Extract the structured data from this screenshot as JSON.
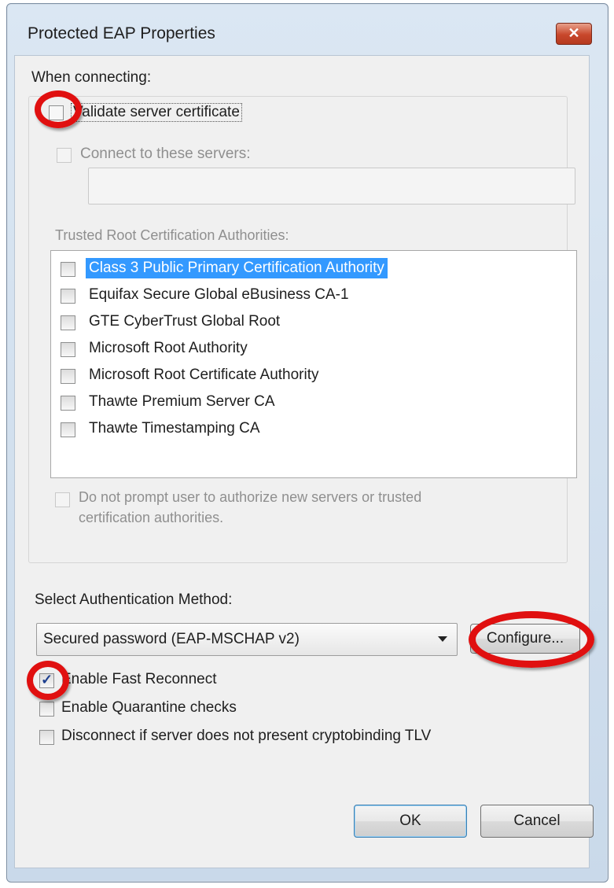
{
  "window": {
    "title": "Protected EAP Properties",
    "close_symbol": "✕"
  },
  "connecting": {
    "heading": "When connecting:",
    "validate_label": "Validate server certificate",
    "validate_checked": false,
    "connect_label": "Connect to these servers:",
    "servers_value": "",
    "trusted_label": "Trusted Root Certification Authorities:",
    "authorities": [
      {
        "label": "Class 3 Public Primary Certification Authority",
        "checked": false,
        "selected": true
      },
      {
        "label": "Equifax Secure Global eBusiness CA-1",
        "checked": false,
        "selected": false
      },
      {
        "label": "GTE CyberTrust Global Root",
        "checked": false,
        "selected": false
      },
      {
        "label": "Microsoft Root Authority",
        "checked": false,
        "selected": false
      },
      {
        "label": "Microsoft Root Certificate Authority",
        "checked": false,
        "selected": false
      },
      {
        "label": "Thawte Premium Server CA",
        "checked": false,
        "selected": false
      },
      {
        "label": "Thawte Timestamping CA",
        "checked": false,
        "selected": false
      }
    ],
    "prompt_label_line1": "Do not prompt user to authorize new servers or trusted",
    "prompt_label_line2": "certification authorities."
  },
  "auth": {
    "heading": "Select Authentication Method:",
    "method_value": "Secured password (EAP-MSCHAP v2)",
    "configure_label": "Configure...",
    "fast_reconnect_label": "Enable Fast Reconnect",
    "fast_reconnect_checked": true,
    "quarantine_label": "Enable Quarantine checks",
    "quarantine_checked": false,
    "cryptobinding_label": "Disconnect if server does not present cryptobinding TLV",
    "cryptobinding_checked": false
  },
  "buttons": {
    "ok_label": "OK",
    "cancel_label": "Cancel"
  },
  "colors": {
    "highlight_ring": "#e01010",
    "selection": "#3399ff"
  }
}
